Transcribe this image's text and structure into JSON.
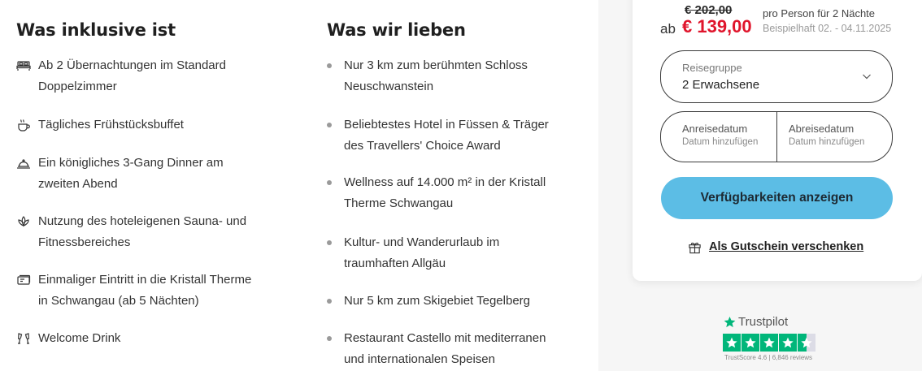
{
  "included": {
    "title": "Was inklusive ist",
    "items": [
      {
        "icon": "bed-icon",
        "line1": "Ab 2 Übernachtungen im Standard",
        "line2": "Doppelzimmer"
      },
      {
        "icon": "coffee-cup-icon",
        "line1": "Tägliches Frühstücksbuffet",
        "line2": ""
      },
      {
        "icon": "cloche-icon",
        "line1": "Ein königliches 3-Gang Dinner am",
        "line2": "zweiten Abend"
      },
      {
        "icon": "lotus-icon",
        "line1": "Nutzung des hoteleigenen Sauna- und",
        "line2": "Fitnessbereiches"
      },
      {
        "icon": "ticket-icon",
        "line1": "Einmaliger Eintritt in die Kristall Therme",
        "line2": "in Schwangau (ab 5 Nächten)"
      },
      {
        "icon": "champagne-glasses-icon",
        "line1": "Welcome Drink",
        "line2": ""
      }
    ]
  },
  "loved": {
    "title": "Was wir lieben",
    "items": [
      {
        "line1": "Nur 3 km zum berühmten Schloss",
        "line2": "Neuschwanstein"
      },
      {
        "line1": "Beliebtestes Hotel in Füssen & Träger",
        "line2": "des Travellers' Choice Award"
      },
      {
        "line1": "Wellness auf 14.000 m² in der Kristall",
        "line2": "Therme Schwangau"
      },
      {
        "line1": "Kultur- und Wanderurlaub im",
        "line2": "traumhaften Allgäu"
      },
      {
        "line1": "Nur 5 km zum Skigebiet Tegelberg",
        "line2": ""
      },
      {
        "line1": "Restaurant Castello mit mediterranen",
        "line2": "und internationalen Speisen"
      }
    ]
  },
  "booking": {
    "old_price": "€ 202,00",
    "price_prefix": "ab",
    "price": "€ 139,00",
    "per_person": "pro Person für 2 Nächte",
    "sample_dates": "Beispielhaft 02. - 04.11.2025",
    "group_label": "Reisegruppe",
    "group_value": "2 Erwachsene",
    "arrival_label": "Anreisedatum",
    "arrival_placeholder": "Datum hinzufügen",
    "departure_label": "Abreisedatum",
    "departure_placeholder": "Datum hinzufügen",
    "cta_label": "Verfügbarkeiten anzeigen",
    "voucher_label": "Als Gutschein verschenken",
    "price_color": "#e0152c",
    "cta_color": "#5cbde5"
  },
  "trustpilot": {
    "brand": "Trustpilot",
    "score_text": "TrustScore 4.6 | 6,846 reviews",
    "rating": 4.5,
    "brand_color": "#00b67a"
  }
}
